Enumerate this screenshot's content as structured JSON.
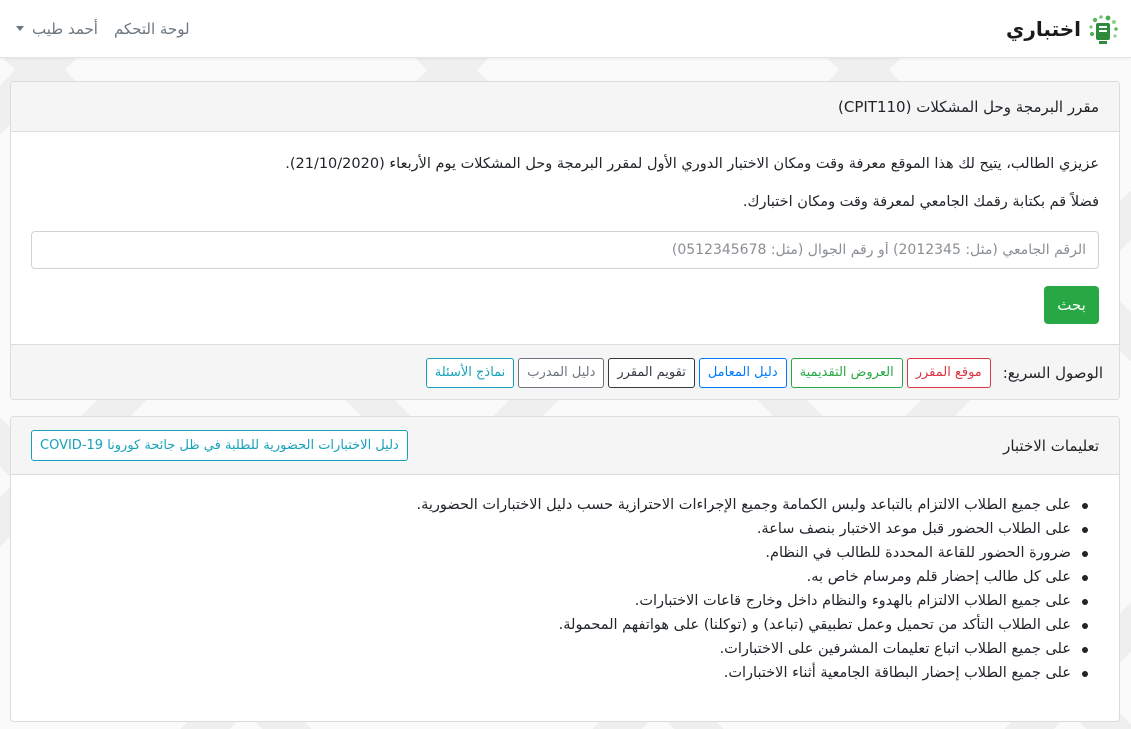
{
  "app": {
    "brand_name": "اختباري"
  },
  "nav": {
    "dashboard_label": "لوحة التحكم",
    "user_name": "أحمد طيب"
  },
  "course_card": {
    "title": "مقرر البرمجة وحل المشكلات (CPIT110)",
    "intro_text": "عزيزي الطالب، يتيح لك هذا الموقع معرفة وقت ومكان الاختبار الدوري الأول لمقرر البرمجة وحل المشكلات يوم الأربعاء (21/10/2020).",
    "prompt_text": "فضلاً قم بكتابة رقمك الجامعي لمعرفة وقت ومكان اختبارك.",
    "search": {
      "placeholder": "الرقم الجامعي (مثل: 2012345) أو رقم الجوال (مثل: 0512345678)",
      "value": "",
      "button_label": "بحث"
    },
    "quick_access": {
      "label": "الوصول السريع:",
      "links": [
        {
          "label": "موقع المقرر",
          "color": "#dc3545"
        },
        {
          "label": "العروض التقديمية",
          "color": "#28a745"
        },
        {
          "label": "دليل المعامل",
          "color": "#007bff"
        },
        {
          "label": "تقويم المقرر",
          "color": "#343a40"
        },
        {
          "label": "دليل المدرب",
          "color": "#6c757d"
        },
        {
          "label": "نماذج الأسئلة",
          "color": "#17a2b8"
        }
      ]
    }
  },
  "instructions_card": {
    "title": "تعليمات الاختبار",
    "guide_button_label": "دليل الاختبارات الحضورية للطلبة في ظل جائحة كورونا COVID-19",
    "items": [
      "على جميع الطلاب الالتزام بالتباعد ولبس الكمامة وجميع الإجراءات الاحترازية حسب دليل الاختبارات الحضورية.",
      "على الطلاب الحضور قبل موعد الاختبار بنصف ساعة.",
      "ضرورة الحضور للقاعة المحددة للطالب في النظام.",
      "على كل طالب إحضار قلم ومرسام خاص به.",
      "على جميع الطلاب الالتزام بالهدوء والنظام داخل وخارج قاعات الاختبارات.",
      "على الطلاب التأكد من تحميل وعمل تطبيقي (تباعد) و (توكلنا) على هواتفهم المحمولة.",
      "على جميع الطلاب اتباع تعليمات المشرفين على الاختبارات.",
      "على جميع الطلاب إحضار البطاقة الجامعية أثناء الاختبارات."
    ]
  },
  "colors": {
    "success": "#28a745",
    "info": "#17a2b8",
    "brand_green": "#2e8b3e"
  }
}
